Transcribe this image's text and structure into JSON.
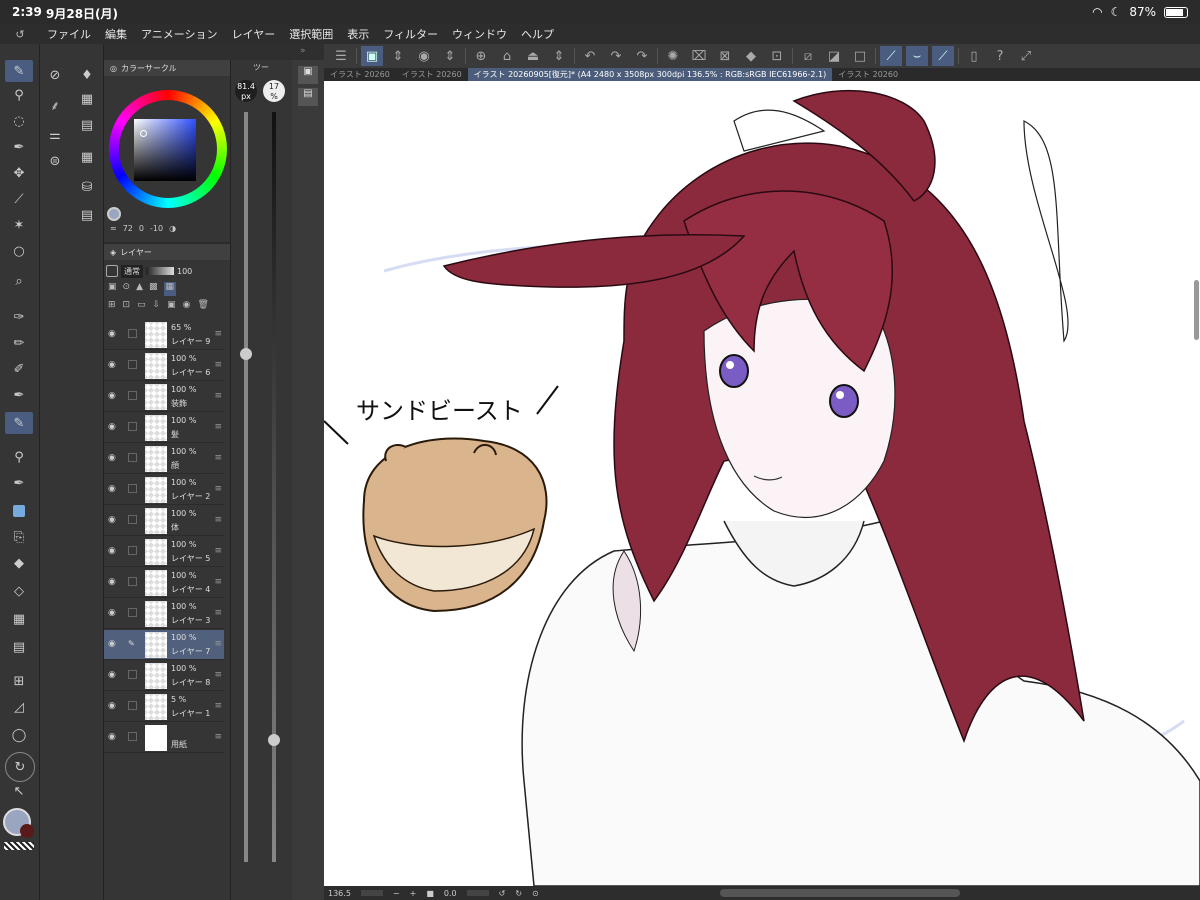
{
  "status": {
    "time": "2:39",
    "date": "9月28日(月)",
    "battery": "87%"
  },
  "menu": [
    "ファイル",
    "編集",
    "アニメーション",
    "レイヤー",
    "選択範囲",
    "表示",
    "フィルター",
    "ウィンドウ",
    "ヘルプ"
  ],
  "tabs": [
    {
      "label": "イラスト 20260"
    },
    {
      "label": "イラスト 20260"
    },
    {
      "label": "イラスト 20260905[復元]* (A4 2480 x 3508px 300dpi 136.5% : RGB:sRGB IEC61966-2.1)"
    },
    {
      "label": "イラスト 20260"
    }
  ],
  "color_panel": {
    "title": "カラーサークル",
    "values": [
      "72",
      "0",
      "-10"
    ]
  },
  "layer_panel": {
    "title": "レイヤー",
    "blend": "通常",
    "opacity": "100"
  },
  "layers": [
    {
      "opacity": "65 %",
      "name": "レイヤー 9"
    },
    {
      "opacity": "100 %",
      "name": "レイヤー 6"
    },
    {
      "opacity": "100 %",
      "name": "装飾"
    },
    {
      "opacity": "100 %",
      "name": "髪"
    },
    {
      "opacity": "100 %",
      "name": "顔"
    },
    {
      "opacity": "100 %",
      "name": "レイヤー 2"
    },
    {
      "opacity": "100 %",
      "name": "体"
    },
    {
      "opacity": "100 %",
      "name": "レイヤー 5"
    },
    {
      "opacity": "100 %",
      "name": "レイヤー 4"
    },
    {
      "opacity": "100 %",
      "name": "レイヤー 3"
    },
    {
      "opacity": "100 %",
      "name": "レイヤー 7",
      "selected": true
    },
    {
      "opacity": "100 %",
      "name": "レイヤー 8"
    },
    {
      "opacity": "5 %",
      "name": "レイヤー 1"
    },
    {
      "opacity": "",
      "name": "用紙"
    }
  ],
  "brush": {
    "size": "81.4",
    "unit": "px",
    "opacity": "17",
    "opacity_unit": "%"
  },
  "tool_panel_title": "ツー",
  "canvas": {
    "handwriting": "サンドビースト"
  },
  "bottom": {
    "zoom": "136.5",
    "angle": "0.0"
  },
  "colors": {
    "accent": "#4a5d80",
    "hair": "#8b2a3c",
    "bun": "#d9b48c"
  }
}
